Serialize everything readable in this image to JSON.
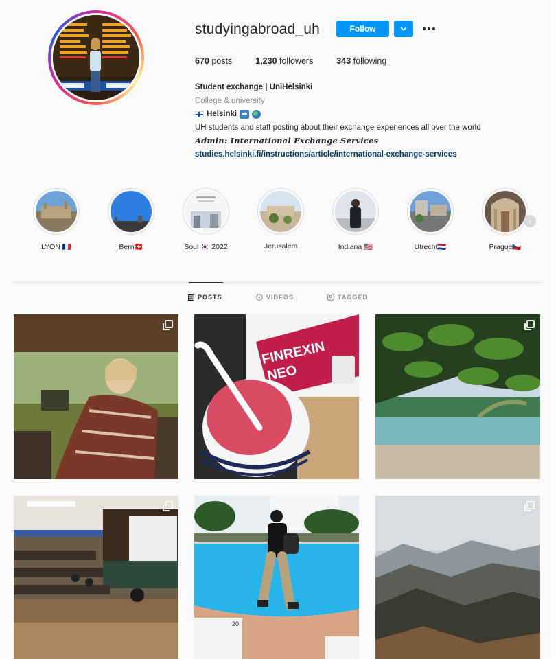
{
  "profile": {
    "username": "studyingabroad_uh",
    "follow_label": "Follow",
    "stats": {
      "posts": "670",
      "posts_label": "posts",
      "followers": "1,230",
      "followers_label": "followers",
      "following": "343",
      "following_label": "following"
    },
    "bio": {
      "name": "Student exchange | UniHelsinki",
      "category": "College & university",
      "location": "Helsinki",
      "description": "UH students and staff posting about their exchange experiences all over the world",
      "admin": "Admin: International Exchange Services",
      "link": "studies.helsinki.fi/instructions/article/international-exchange-services"
    }
  },
  "highlights": [
    {
      "label": "LYON 🇫🇷"
    },
    {
      "label": "Bern🇨🇭"
    },
    {
      "label": "Soul 🇰🇷 2022"
    },
    {
      "label": "Jerusalem"
    },
    {
      "label": "Indiana 🇺🇸"
    },
    {
      "label": "Utrecht🇳🇱"
    },
    {
      "label": "Prague🇨🇿"
    }
  ],
  "tabs": {
    "posts": "POSTS",
    "videos": "VIDEOS",
    "tagged": "TAGGED"
  },
  "post_art": {
    "p2_brand": "FINREXIN\nNEO",
    "p5_sign": "20"
  },
  "colors": {
    "accent": "#0095f6",
    "link": "#00376b",
    "muted": "#8e8e8e"
  },
  "icons": [
    "chevron-down-icon",
    "more-icon",
    "posts-grid-icon",
    "video-icon",
    "tagged-icon",
    "carousel-icon",
    "chevron-right-icon"
  ]
}
